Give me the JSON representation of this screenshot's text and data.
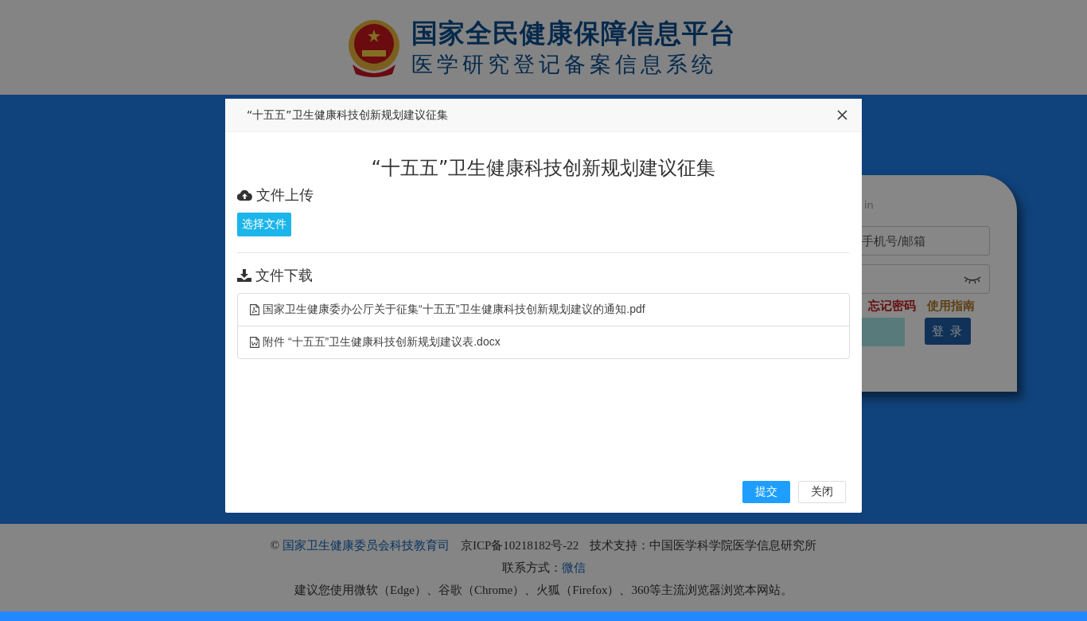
{
  "header": {
    "title": "国家全民健康保障信息平台",
    "subtitle": "医学研究登记备案信息系统"
  },
  "login": {
    "heading_fragment": "in",
    "account_placeholder": "手机号/邮箱",
    "forgot_link": "忘记密码",
    "guide_link": "使用指南",
    "login_button": "登 录"
  },
  "modal": {
    "title": "“十五五”卫生健康科技创新规划建议征集",
    "heading": "“十五五”卫生健康科技创新规划建议征集",
    "upload_section": {
      "title": "文件上传",
      "button": "选择文件"
    },
    "download_section": {
      "title": "文件下载",
      "files": [
        {
          "kind": "pdf",
          "name": "国家卫生健康委办公厅关于征集“十五五”卫生健康科技创新规划建议的通知.pdf"
        },
        {
          "kind": "word",
          "name": "附件 “十五五”卫生健康科技创新规划建议表.docx"
        }
      ]
    },
    "buttons": [
      {
        "kind": "primary",
        "label": "提交"
      },
      {
        "kind": "default",
        "label": "关闭"
      }
    ]
  },
  "footer": {
    "copyright_sign": "©",
    "department_link": "国家卫生健康委员会科技教育司",
    "icp": "京ICP备10218182号-22",
    "support": "技术支持：中国医学科学院医学信息研究所",
    "contact_label": "联系方式：",
    "contact_link": "微信",
    "browser_note": "建议您使用微软（Edge）、谷歌（Chrome）、火狐（Firefox）、360等主流浏览器浏览本网站。"
  }
}
